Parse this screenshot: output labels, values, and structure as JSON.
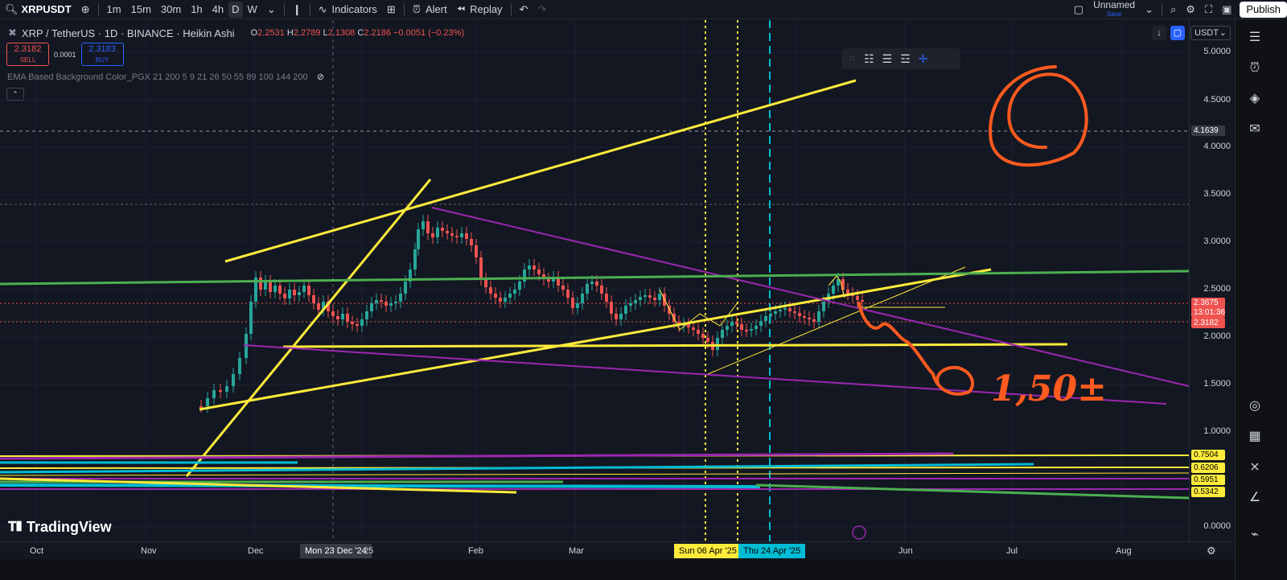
{
  "toolbar": {
    "symbol": "XRPUSDT",
    "intervals": [
      "1m",
      "15m",
      "30m",
      "1h",
      "4h",
      "D",
      "W"
    ],
    "active_interval": "D",
    "indicators": "Indicators",
    "alert": "Alert",
    "replay": "Replay",
    "layout_name": "Unnamed",
    "layout_status": "Save",
    "publish": "Publish"
  },
  "legend": {
    "title": "XRP / TetherUS · 1D · BINANCE · Heikin Ashi",
    "o_label": "O",
    "o": "2.2531",
    "h_label": "H",
    "h": "2.2789",
    "l_label": "L",
    "l": "2.1308",
    "c_label": "C",
    "c": "2.2186",
    "change": "−0.0051 (−0.23%)",
    "sell_price": "2.3182",
    "sell_label": "SELL",
    "spread": "0.0001",
    "buy_price": "2.3183",
    "buy_label": "BUY",
    "indicator": "EMA Based Background Color_PGX 21 200 5 9 21 26 50 55 89 100 144 200"
  },
  "price_axis": {
    "currency": "USDT",
    "ticks": [
      "5.0000",
      "4.5000",
      "4.0000",
      "3.5000",
      "3.0000",
      "2.5000",
      "2.0000",
      "1.5000",
      "1.0000",
      "0.0000"
    ],
    "tags": {
      "crosshair": "4.1639",
      "last": "2.3675",
      "countdown": "13:01:36",
      "bid": "2.3182",
      "l1": "0.7504",
      "l2": "0.6206",
      "l3": "0.5951",
      "l4": "0.5342"
    }
  },
  "time_axis": {
    "labels": [
      "Oct",
      "Nov",
      "Dec",
      "Mon 23 Dec '24",
      "25",
      "Feb",
      "Mar",
      "Sun 06 Apr '25",
      "Thu 24 Apr '25",
      "Jun",
      "Jul",
      "Aug"
    ]
  },
  "annotation": {
    "target": "1,50±"
  },
  "branding": {
    "logo": "TradingView"
  },
  "colors": {
    "background": "#131722",
    "up": "#26a69a",
    "down": "#ef5350",
    "trendline_yellow": "#ffeb3b",
    "trendline_purple": "#9c27b0",
    "trendline_green": "#4caf50",
    "annotation_orange": "#ff5a1f",
    "vline_cyan": "#00bcd4"
  }
}
